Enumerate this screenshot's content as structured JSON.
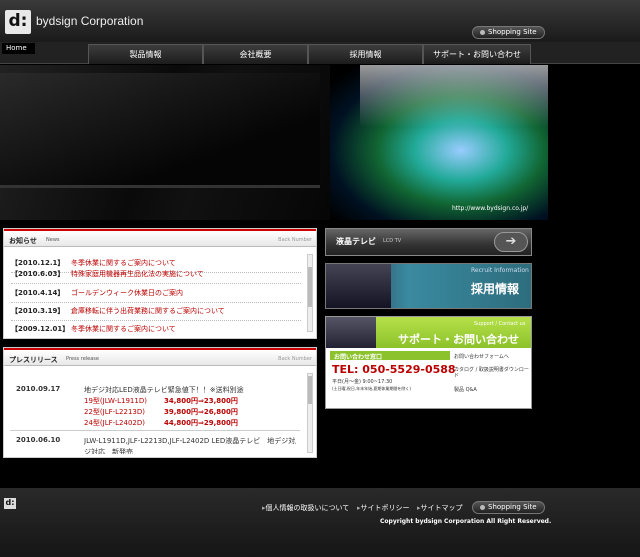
{
  "header": {
    "logo_mark": "d:",
    "company": "bydsign Corporation",
    "shopping_site": "Shopping Site"
  },
  "nav": {
    "home": "Home",
    "tabs": [
      "製品情報",
      "会社概要",
      "採用情報",
      "サポート・お問い合わせ"
    ]
  },
  "hero": {
    "url": "http://www.bydsign.co.jp/"
  },
  "news": {
    "title": "お知らせ",
    "subtitle": "News",
    "back_number": "Back Number",
    "items": [
      {
        "date": "【2010.12.1】",
        "text": "冬季休業に関するご案内について"
      },
      {
        "date": "【2010.6.03】",
        "text": "特殊家庭用機器再生品化法の実施について"
      },
      {
        "date": "【2010.4.14】",
        "text": "ゴールデンウィーク休業日のご案内"
      },
      {
        "date": "【2010.3.19】",
        "text": "倉庫移転に伴う出荷業務に関するご案内について"
      },
      {
        "date": "【2009.12.01】",
        "text": "冬季休業に関するご案内について"
      }
    ]
  },
  "press": {
    "title": "プレスリリース",
    "subtitle": "Press release",
    "back_number": "Back Number",
    "entries": [
      {
        "date": "2010.09.17",
        "headline": "地デジ対応LED液晶テレビ緊急値下！！※送料別途",
        "prices": [
          {
            "model": "19型(JLW-L1911D)",
            "price": "34,800円⇒23,800円"
          },
          {
            "model": "22型(JLF-L2213D)",
            "price": "39,800円⇒26,800円"
          },
          {
            "model": "24型(JLF-L2402D)",
            "price": "44,800円⇒29,800円"
          }
        ]
      },
      {
        "date": "2010.06.10",
        "headline": "JLW-L1911D,JLF-L2213D,JLF-L2402D LED液晶テレビ　地デジ対応",
        "headline2": "ジ対応　新発売"
      }
    ]
  },
  "banners": {
    "lcd_title": "液晶テレビ",
    "lcd_sub": "LCD TV",
    "recruit_en": "Recruit Information",
    "recruit_jp": "採用情報",
    "support_en": "Support / Contact us",
    "support_jp": "サポート・お問い合わせ",
    "contact_window": "お問い合わせ窓口",
    "tel": "TEL: 050-5529-0588",
    "hours": "平日(月～金) 9:00~17:30",
    "hours_note": "(土日曜,祝日,年末年始,夏期休業期間を除く)",
    "links": [
      "お問い合わせフォームへ",
      "カタログ / 取扱説明書ダウンロード",
      "製品 Q&A"
    ]
  },
  "footer": {
    "logo_mark": "d:",
    "links": [
      "個人情報の取扱いについて",
      "サイトポリシー",
      "サイトマップ"
    ],
    "shopping_site": "Shopping Site",
    "copyright": "Copyright bydsign Corporation All Right Reserved."
  },
  "colors": {
    "accent_red": "#bb0000",
    "support_green": "#9acd32",
    "recruit_teal": "#3a8aa0"
  }
}
